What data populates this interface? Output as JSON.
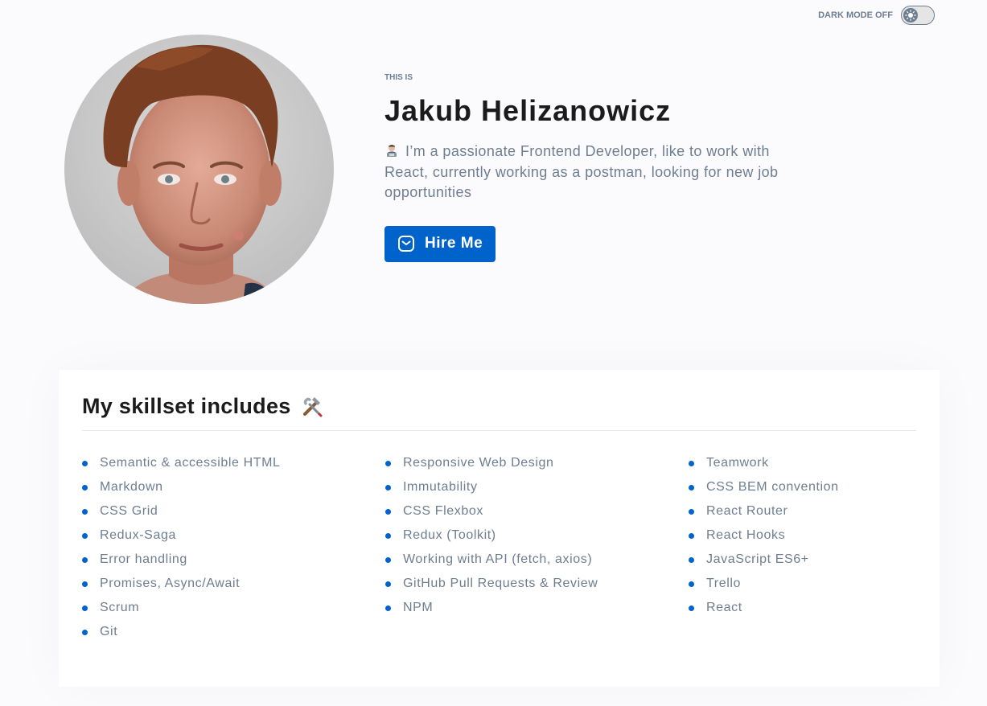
{
  "theme_toggle": {
    "label": "DARK MODE OFF",
    "state": "off",
    "icon": "sun-icon"
  },
  "header": {
    "eyebrow": "THIS IS",
    "name": "Jakub Helizanowicz",
    "bio_icon": "technologist-icon",
    "bio": "I’m a passionate Frontend Developer, like to work with React, currently working as a postman, looking for new job opportunities",
    "hire_button": {
      "label": "Hire Me",
      "icon": "envelope-icon"
    },
    "avatar": "profile-photo"
  },
  "skills": {
    "title": "My skillset includes",
    "title_icon": "hammer-and-wrench-icon",
    "items": [
      "Semantic & accessible HTML",
      "Markdown",
      "CSS Grid",
      "Redux-Saga",
      "Error handling",
      "Promises, Async/Await",
      "Scrum",
      "Git",
      "Responsive Web Design",
      "Immutability",
      "CSS Flexbox",
      "Redux (Toolkit)",
      "Working with API (fetch, axios)",
      "GitHub Pull Requests & Review",
      "NPM",
      "Teamwork",
      "CSS BEM convention",
      "React Router",
      "React Hooks",
      "JavaScript ES6+",
      "Trello",
      "React"
    ]
  },
  "colors": {
    "background": "#fbfbfe",
    "accent": "#0063cc",
    "text_muted": "#6e7e91",
    "text_dark": "#1b1b1b",
    "card": "#ffffff"
  }
}
